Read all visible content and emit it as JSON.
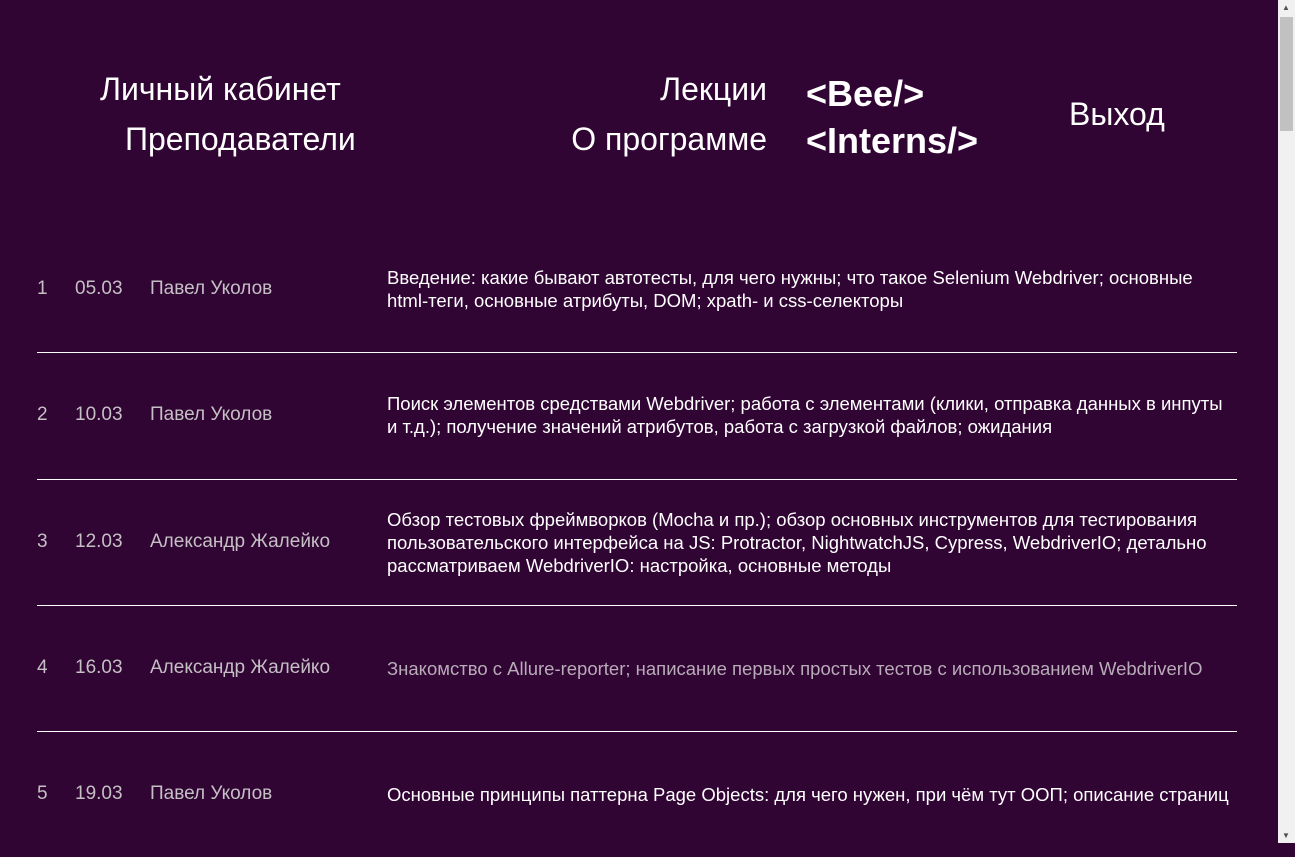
{
  "header": {
    "nav_left": [
      "Личный кабинет",
      "Преподаватели"
    ],
    "nav_right": [
      "Лекции",
      "О программе"
    ],
    "logo": [
      "<Bee/>",
      "<Interns/>"
    ],
    "logout": "Выход"
  },
  "lectures": [
    {
      "num": "1",
      "date": "05.03",
      "teacher": "Павел Уколов",
      "topic": "Введение: какие бывают автотесты, для чего нужны; что такое Selenium Webdriver; основные html-теги, основные атрибуты, DOM; xpath- и css-селекторы"
    },
    {
      "num": "2",
      "date": "10.03",
      "teacher": "Павел Уколов",
      "topic": "Поиск элементов средствами Webdriver; работа с элементами (клики, отправка данных в инпуты и т.д.); получение значений атрибутов, работа с загрузкой файлов; ожидания"
    },
    {
      "num": "3",
      "date": "12.03",
      "teacher": "Александр Жалейко",
      "topic": "Обзор тестовых фреймворков (Mocha и пр.); обзор основных инструментов для тестирования пользовательского интерфейса на JS: Protractor, NightwatchJS, Cypress, WebdriverIO; детально рассматриваем WebdriverIO: настройка, основные методы"
    },
    {
      "num": "4",
      "date": "16.03",
      "teacher": "Александр Жалейко",
      "topic": "Знакомство с Allure-reporter; написание первых простых тестов с использованием WebdriverIO"
    },
    {
      "num": "5",
      "date": "19.03",
      "teacher": "Павел Уколов",
      "topic": "Основные принципы паттерна Page Objects: для чего нужен, при чём тут ООП; описание страниц"
    }
  ]
}
